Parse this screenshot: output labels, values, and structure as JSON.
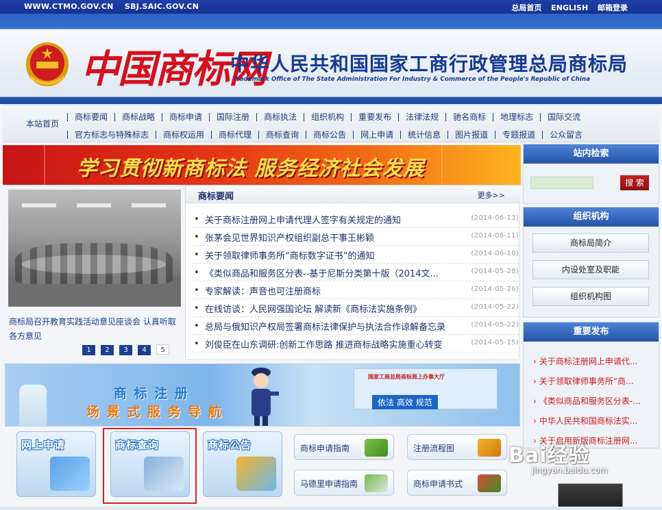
{
  "topbar": {
    "links_left": [
      "WWW.CTMO.GOV.CN",
      "SBJ.SAIC.GOV.CN"
    ],
    "links_right": [
      "总局首页",
      "ENGLISH",
      "邮箱登录"
    ]
  },
  "header": {
    "logo_text": "中国商标网",
    "org_cn": "中华人民共和国国家工商行政管理总局商标局",
    "org_en": "Trademark Office of The State Administration For Industry & Commerce of the People's Republic of China"
  },
  "nav": {
    "home": "本站首页",
    "row1": [
      "商标要闻",
      "商标战略",
      "商标申请",
      "国际注册",
      "商标执法",
      "组织机构",
      "重要发布",
      "法律法规",
      "驰名商标",
      "地理标志",
      "国际交流"
    ],
    "row2": [
      "官方标志与特殊标志",
      "商标权运用",
      "商标代理",
      "商标查询",
      "商标公告",
      "网上申请",
      "统计信息",
      "图片报道",
      "专题报道",
      "公众留言"
    ]
  },
  "slogan": "学习贯彻新商标法 服务经济社会发展",
  "photo_news": {
    "caption": "商标局召开教育实践活动意见座谈会 认真听取各方意见",
    "pages": [
      "1",
      "2",
      "3",
      "4",
      "5"
    ],
    "active_page": "5"
  },
  "news": {
    "title": "商标要闻",
    "more": "更多>>",
    "items": [
      {
        "title": "关于商标注册网上申请代理人签字有关规定的通知",
        "date": "(2014-06-13)"
      },
      {
        "title": "张茅会见世界知识产权组织副总干事王彬颖",
        "date": "(2014-06-11)"
      },
      {
        "title": "关于领取律师事务所“商标数字证书”的通知",
        "date": "(2014-06-10)"
      },
      {
        "title": "《类似商品和服务区分表--基于尼斯分类第十版（2014文...",
        "date": "(2014-05-28)"
      },
      {
        "title": "专家解读：声音也可注册商标",
        "date": "(2014-05-26)"
      },
      {
        "title": "在线访谈：人民网强国论坛 解读新《商标法实施条例》",
        "date": "(2014-05-22)"
      },
      {
        "title": "总局与俄知识产权局签署商标法律保护与执法合作谅解备忘录",
        "date": "(2014-05-22)"
      },
      {
        "title": "刘俊臣在山东调研:创新工作思路 推进商标战略实施重心转变",
        "date": "(2014-05-15)"
      }
    ]
  },
  "sidebar": {
    "search": {
      "title": "站内检索",
      "button": "搜 索",
      "placeholder": ""
    },
    "org": {
      "title": "组织机构",
      "buttons": [
        "商标局简介",
        "内设处室及职能",
        "组织机构图"
      ]
    },
    "release": {
      "title": "重要发布",
      "items": [
        "关于商标注册网上申请代...",
        "关于领取律师事务所“商...",
        "《类似商品和服务区分表-...",
        "中华人民共和国商标法实...",
        "关于启用新版商标注册网..."
      ]
    }
  },
  "guide": {
    "line1": "商 标 注 册",
    "line2": "场 景 式 服 务 导 航",
    "hall_title": "国家工商总局商标局上办事大厅",
    "hall_slogan": "依法 高效 规范"
  },
  "tiles": {
    "big": [
      "网上申请",
      "商标查询",
      "商标公告"
    ],
    "small": [
      "商标申请指南",
      "注册流程图",
      "马德里申请指南",
      "商标申请书式"
    ]
  },
  "watermark": {
    "brand": "Bai经验",
    "url": "jingyan.baidu.com"
  },
  "colors": {
    "brand_blue": "#1f3fa8",
    "logo_red": "#d4101c",
    "selection_red": "#d9201f",
    "release_red": "#cc1b1b"
  }
}
